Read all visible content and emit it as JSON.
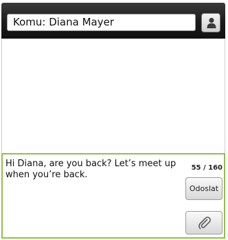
{
  "header": {
    "to_field_value": "Komu: Diana Mayer",
    "contact_icon": "person-icon"
  },
  "composer": {
    "message_text": "Hi Diana, are you back? Let’s meet up when you’re back.",
    "char_counter": "55 / 160",
    "send_label": "Odoslat",
    "attach_icon": "paperclip-icon"
  },
  "colors": {
    "composer_border": "#8fc04a",
    "header_bg": "#1b1b1b"
  }
}
